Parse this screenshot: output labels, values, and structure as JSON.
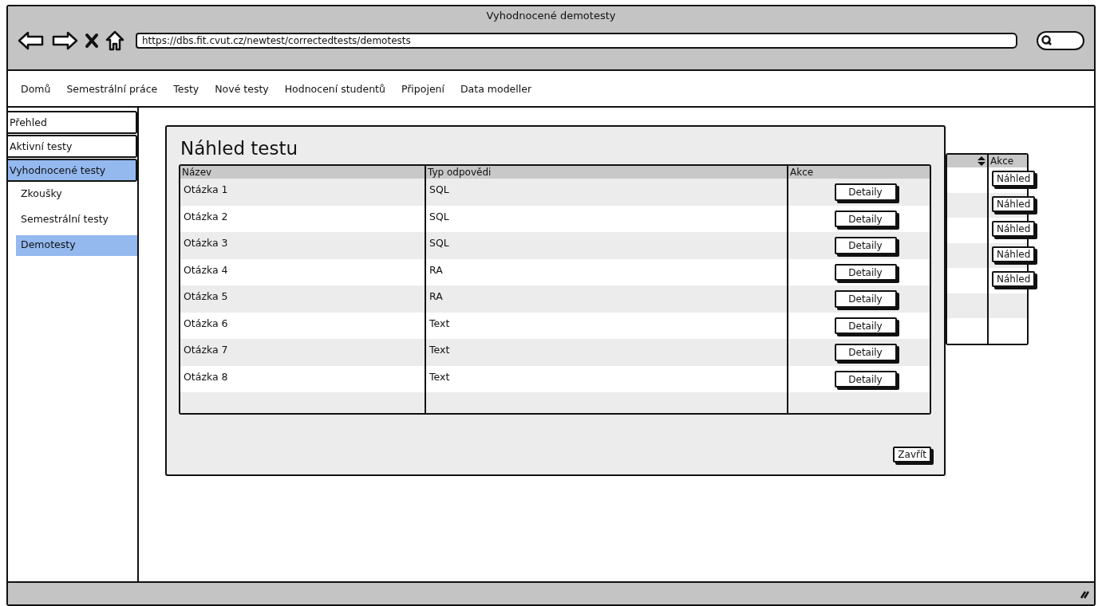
{
  "window": {
    "title": "Vyhodnocené demotesty",
    "url": "https://dbs.fit.cvut.cz/newtest/correctedtests/demotests"
  },
  "nav": {
    "items": [
      "Domů",
      "Semestrální práce",
      "Testy",
      "Nové testy",
      "Hodnocení studentů",
      "Připojení",
      "Data modeller"
    ]
  },
  "sidebar": {
    "items": [
      {
        "label": "Přehled",
        "selected": false
      },
      {
        "label": "Aktivní testy",
        "selected": false
      },
      {
        "label": "Vyhodnocené testy",
        "selected": true,
        "children": [
          {
            "label": "Zkoušky",
            "selected": false
          },
          {
            "label": "Semestrální testy",
            "selected": false
          },
          {
            "label": "Demotesty",
            "selected": true
          }
        ]
      }
    ]
  },
  "background_table": {
    "columns": [
      "Akce"
    ],
    "rows": [
      {
        "action": "Náhled"
      },
      {
        "action": "Náhled"
      },
      {
        "action": "Náhled"
      },
      {
        "action": "Náhled"
      },
      {
        "action": "Náhled"
      }
    ]
  },
  "modal": {
    "title": "Náhled testu",
    "columns": [
      "Název",
      "Typ odpovědi",
      "Akce"
    ],
    "rows": [
      {
        "name": "Otázka 1",
        "type": "SQL",
        "action": "Detaily"
      },
      {
        "name": "Otázka 2",
        "type": "SQL",
        "action": "Detaily"
      },
      {
        "name": "Otázka 3",
        "type": "SQL",
        "action": "Detaily"
      },
      {
        "name": "Otázka 4",
        "type": "RA",
        "action": "Detaily"
      },
      {
        "name": "Otázka 5",
        "type": "RA",
        "action": "Detaily"
      },
      {
        "name": "Otázka 6",
        "type": "Text",
        "action": "Detaily"
      },
      {
        "name": "Otázka 7",
        "type": "Text",
        "action": "Detaily"
      },
      {
        "name": "Otázka 8",
        "type": "Text",
        "action": "Detaily"
      }
    ],
    "close_button": "Zavřít"
  }
}
